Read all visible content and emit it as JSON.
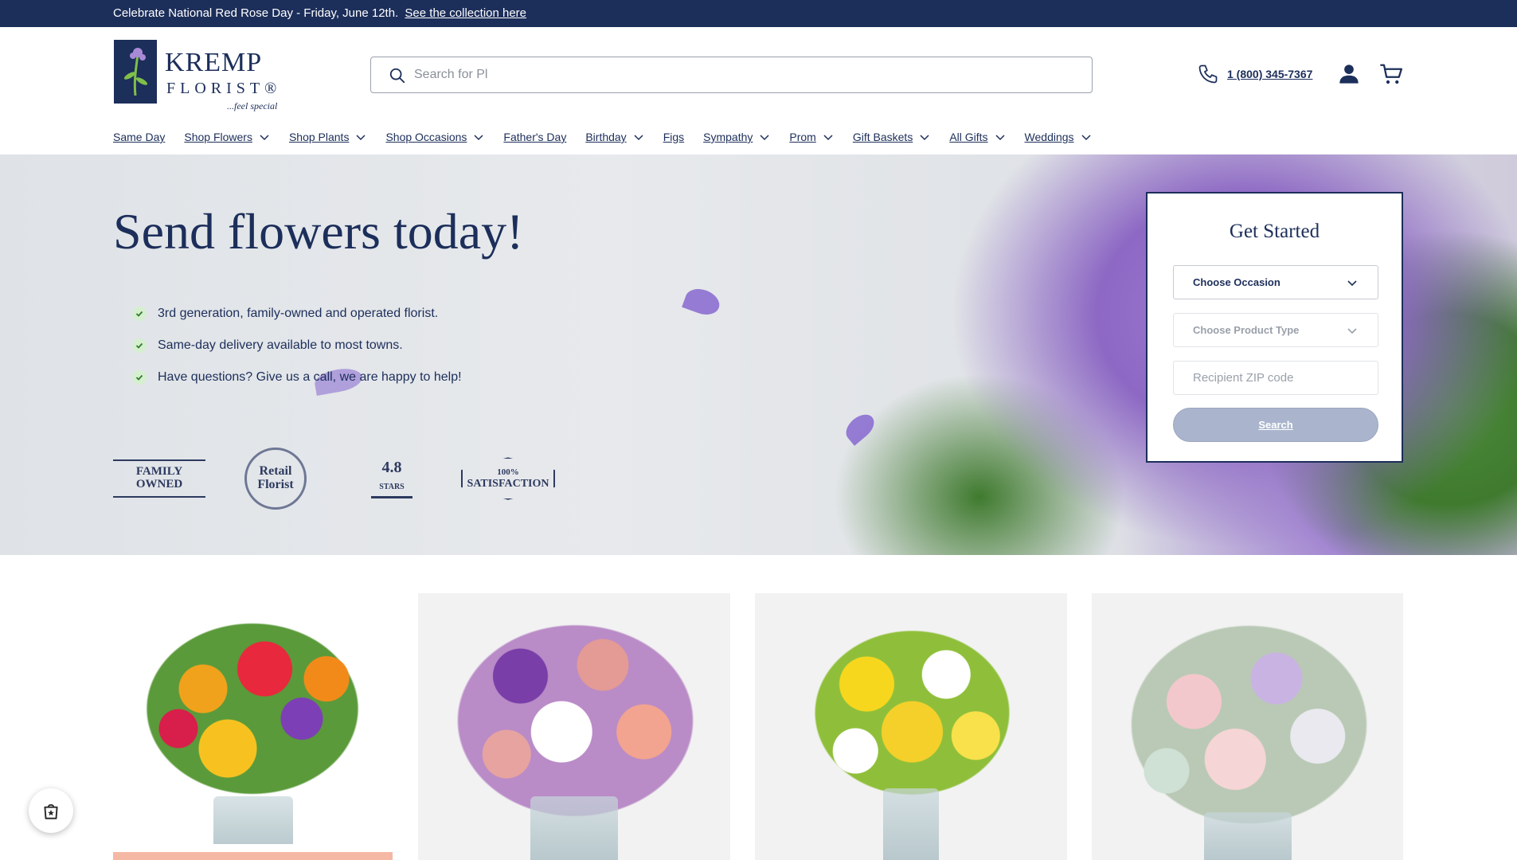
{
  "announcement": {
    "text": "Celebrate National Red Rose Day - Friday, June 12th.",
    "link_label": "See the collection here"
  },
  "brand": {
    "name_top": "KREMP",
    "name_bottom": "FLORIST®",
    "tagline": "...feel special",
    "color": "#1c2e5a"
  },
  "search": {
    "placeholder": "Search for Pl"
  },
  "header": {
    "phone": "1 (800) 345-7367"
  },
  "nav": [
    {
      "label": "Same Day",
      "dropdown": false
    },
    {
      "label": "Shop Flowers",
      "dropdown": true
    },
    {
      "label": "Shop Plants",
      "dropdown": true
    },
    {
      "label": "Shop Occasions",
      "dropdown": true
    },
    {
      "label": "Father's Day",
      "dropdown": false
    },
    {
      "label": "Birthday",
      "dropdown": true
    },
    {
      "label": "Figs",
      "dropdown": false
    },
    {
      "label": "Sympathy",
      "dropdown": true
    },
    {
      "label": "Prom",
      "dropdown": true
    },
    {
      "label": "Gift Baskets",
      "dropdown": true
    },
    {
      "label": "All Gifts",
      "dropdown": true
    },
    {
      "label": "Weddings",
      "dropdown": true
    }
  ],
  "hero": {
    "title": "Send flowers today!",
    "bullets": [
      "3rd generation, family-owned and operated florist.",
      "Same-day delivery available to most towns.",
      "Have questions? Give us a call, we are happy to help!"
    ],
    "badges": [
      {
        "line1": "FAMILY OWNED",
        "line2": ""
      },
      {
        "line1": "Retail",
        "line2": "Florist"
      },
      {
        "line1": "4.8",
        "line2": "STARS"
      },
      {
        "line1": "100%",
        "line2": "SATISFACTION"
      }
    ]
  },
  "get_started": {
    "title": "Get Started",
    "occasion_label": "Choose Occasion",
    "product_type_label": "Choose Product Type",
    "zip_placeholder": "Recipient ZIP code",
    "search_label": "Search"
  }
}
